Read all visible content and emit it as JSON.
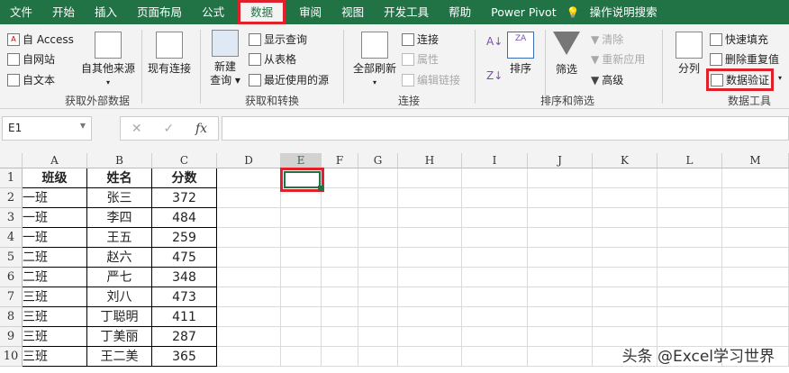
{
  "tabs": [
    "文件",
    "开始",
    "插入",
    "页面布局",
    "公式",
    "数据",
    "审阅",
    "视图",
    "开发工具",
    "帮助",
    "Power Pivot",
    "操作说明搜索"
  ],
  "active_tab": "数据",
  "ribbon": {
    "get_external": {
      "access": "自 Access",
      "web": "自网站",
      "text": "自文本",
      "other": "自其他来源",
      "existing": "现有连接",
      "label": "获取外部数据"
    },
    "get_transform": {
      "new_query_1": "新建",
      "new_query_2": "查询",
      "show": "显示查询",
      "table": "从表格",
      "recent": "最近使用的源",
      "label": "获取和转换"
    },
    "connections": {
      "refresh": "全部刷新",
      "conn": "连接",
      "props": "属性",
      "edit": "编辑链接",
      "label": "连接"
    },
    "sort_filter": {
      "sort": "排序",
      "filter": "筛选",
      "clear": "清除",
      "reapply": "重新应用",
      "advanced": "高级",
      "label": "排序和筛选"
    },
    "data_tools": {
      "split": "分列",
      "flash": "快速填充",
      "dedupe": "删除重复值",
      "validate": "数据验证",
      "label": "数据工具"
    }
  },
  "formula_bar": {
    "name_box": "E1",
    "fx": "fx",
    "value": ""
  },
  "columns": [
    "A",
    "B",
    "C",
    "D",
    "E",
    "F",
    "G",
    "H",
    "I",
    "J",
    "K",
    "L",
    "M"
  ],
  "rows": [
    "1",
    "2",
    "3",
    "4",
    "5",
    "6",
    "7",
    "8",
    "9",
    "10"
  ],
  "table": {
    "headers": [
      "班级",
      "姓名",
      "分数"
    ],
    "data": [
      [
        "一班",
        "张三",
        "372"
      ],
      [
        "一班",
        "李四",
        "484"
      ],
      [
        "一班",
        "王五",
        "259"
      ],
      [
        "二班",
        "赵六",
        "475"
      ],
      [
        "二班",
        "严七",
        "348"
      ],
      [
        "三班",
        "刘八",
        "473"
      ],
      [
        "三班",
        "丁聪明",
        "411"
      ],
      [
        "三班",
        "丁美丽",
        "287"
      ],
      [
        "三班",
        "王二美",
        "365"
      ]
    ]
  },
  "watermark": "头条 @Excel学习世界"
}
